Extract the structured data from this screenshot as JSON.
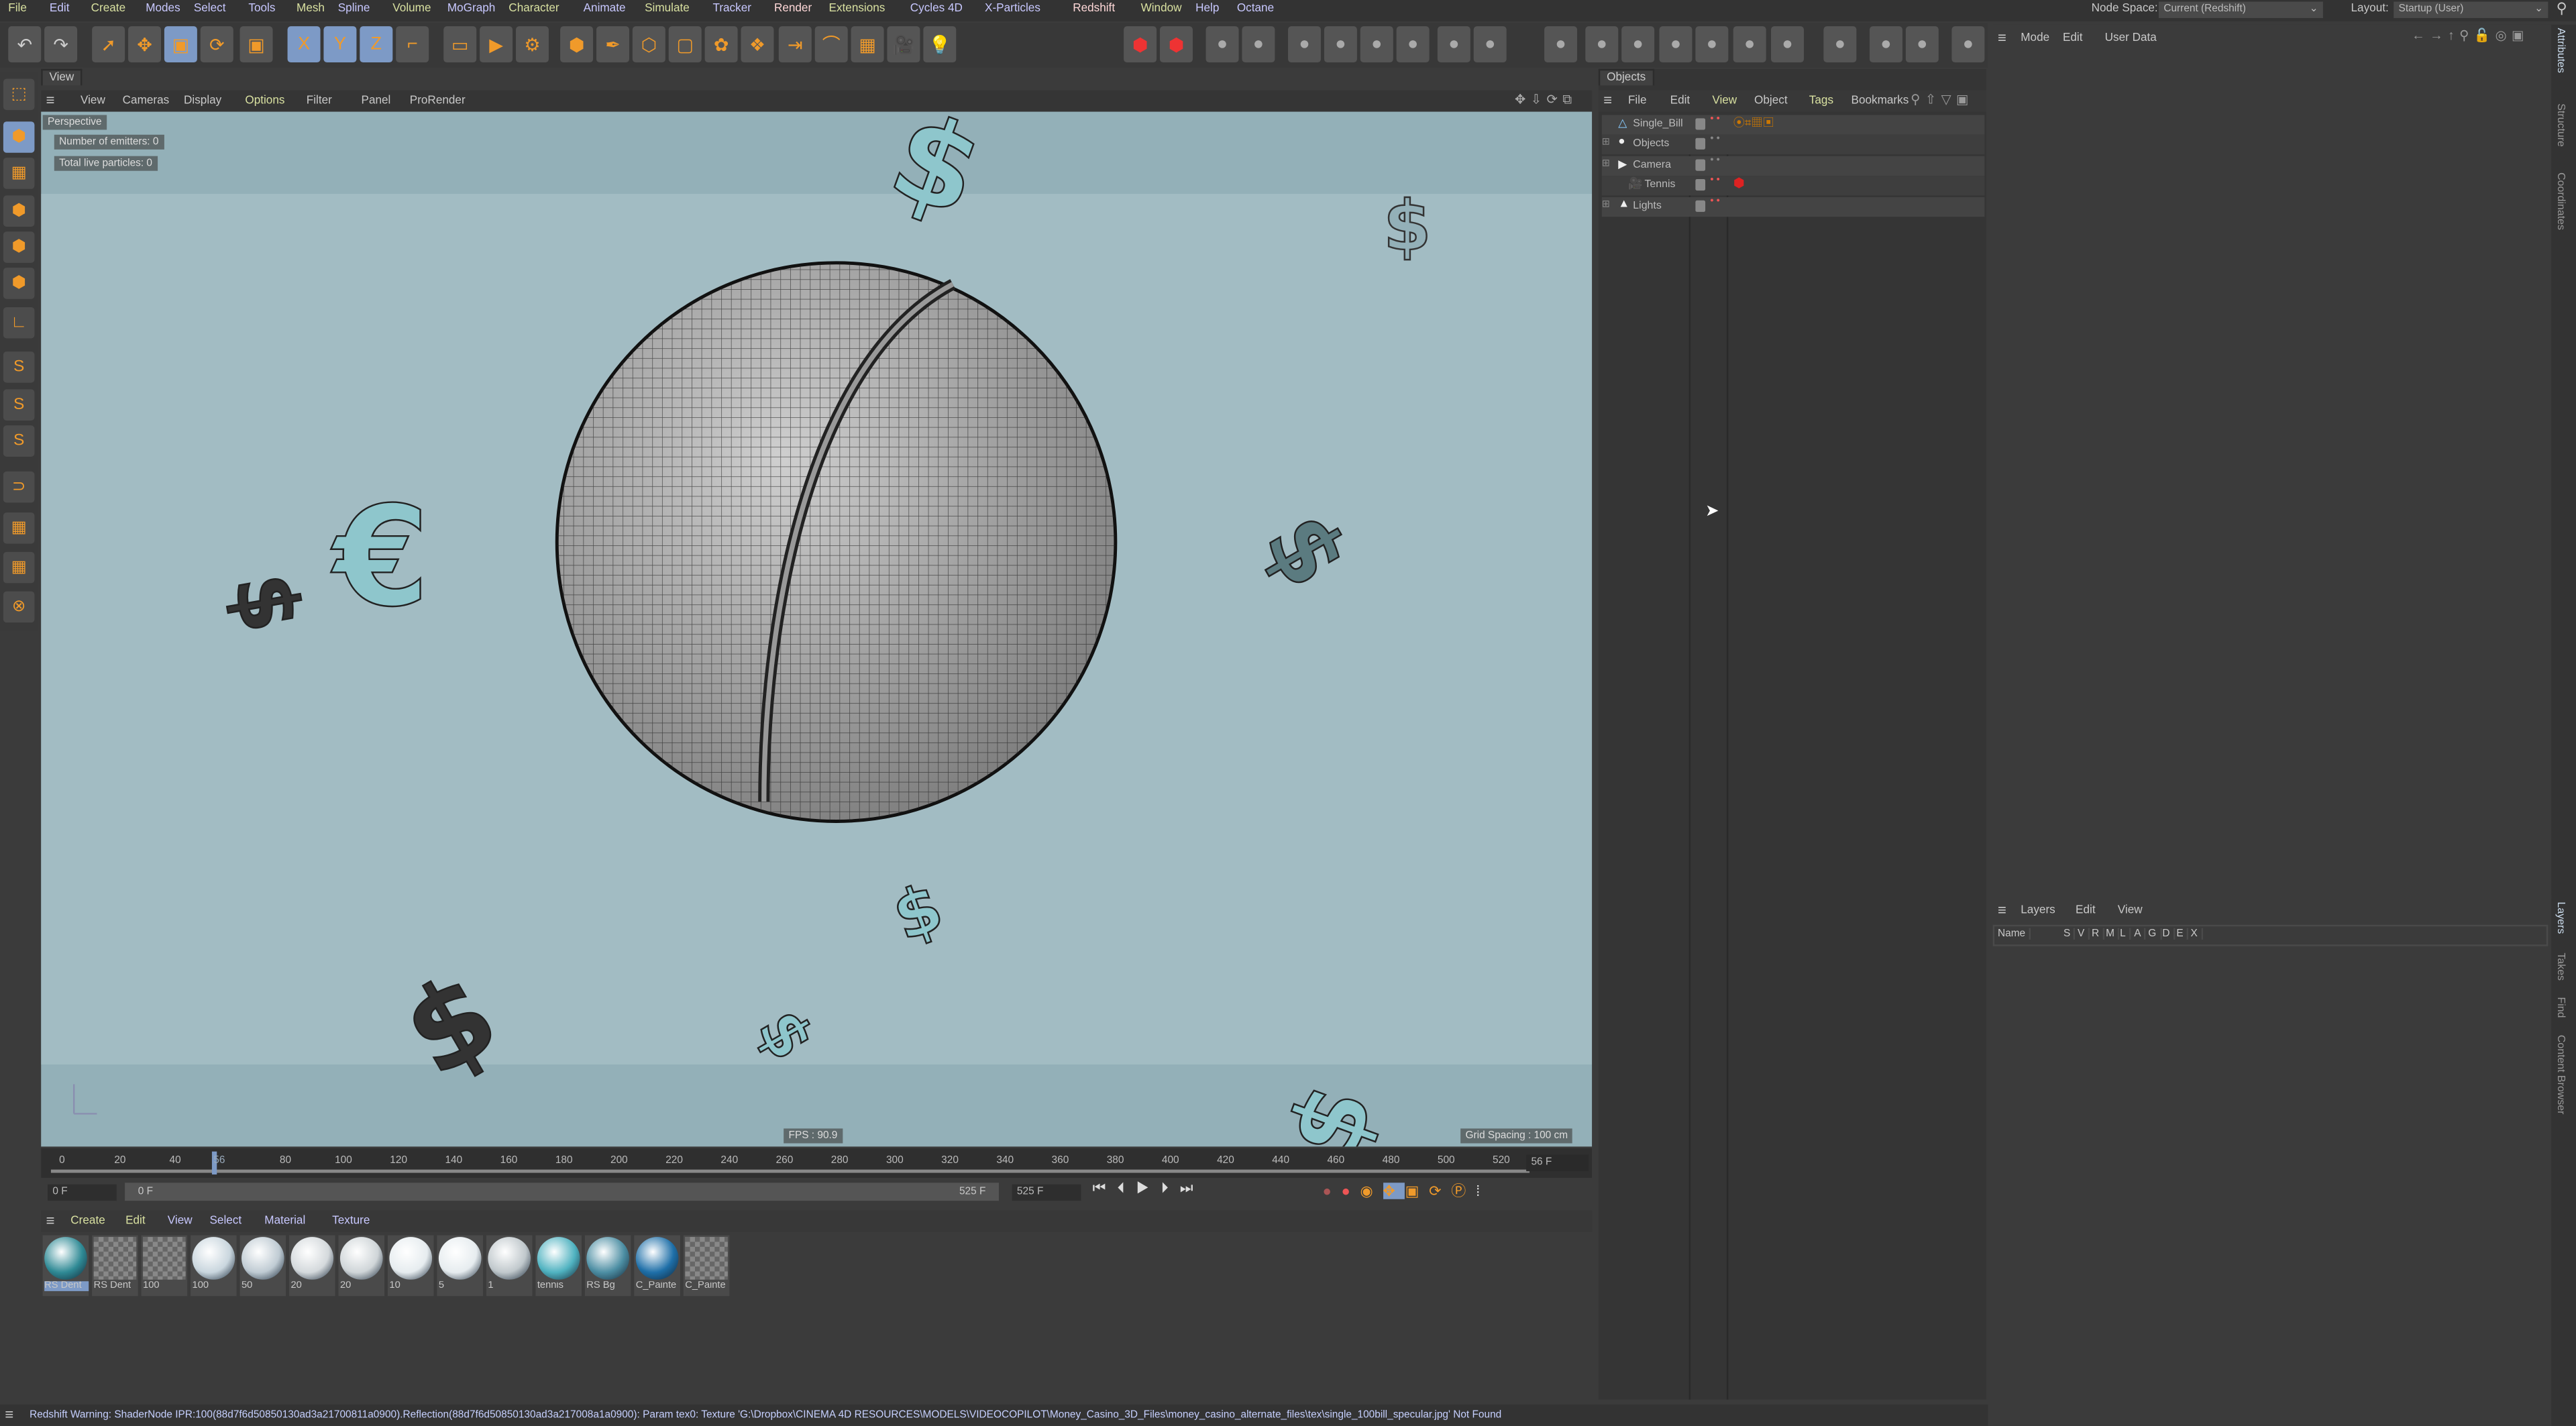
{
  "menubar": {
    "items": [
      "File",
      "Edit",
      "Create",
      "Modes",
      "Select",
      "Tools",
      "Mesh",
      "Spline",
      "Volume",
      "MoGraph",
      "Character",
      "Animate",
      "Simulate",
      "Tracker",
      "Render",
      "Extensions",
      "Cycles 4D",
      "X-Particles",
      "Redshift",
      "Window",
      "Help",
      "Octane"
    ],
    "node_space_label": "Node Space:",
    "node_space_value": "Current (Redshift)",
    "layout_label": "Layout:",
    "layout_value": "Startup (User)"
  },
  "toolbar": {
    "icons": [
      "undo-icon",
      "redo-icon",
      "select-icon",
      "move-icon",
      "scale-icon",
      "rotate-icon",
      "live-select-icon",
      "x-axis-icon",
      "y-axis-icon",
      "z-axis-icon",
      "coordinate-system-icon",
      "render-view-icon",
      "render-icon",
      "render-settings-icon",
      "cube-icon",
      "pen-icon",
      "subdivision-icon",
      "extrude-icon",
      "cloner-icon",
      "mograph-icon",
      "deformer-icon",
      "bend-icon",
      "floor-icon",
      "camera-icon",
      "light-icon"
    ],
    "axis_labels": [
      "X",
      "Y",
      "Z"
    ]
  },
  "viewport": {
    "tab": "View",
    "menu": [
      "View",
      "Cameras",
      "Display",
      "Options",
      "Filter",
      "Panel",
      "ProRender"
    ],
    "camera": "Perspective",
    "hud_emitters": "Number of emitters: 0",
    "hud_particles": "Total live particles: 0",
    "fps": "FPS : 90.9",
    "grid_spacing": "Grid Spacing : 100 cm",
    "background_color": "#93b0b8",
    "sky_color": "#a2bcc3",
    "symbol_color": "#8ec6cc"
  },
  "timeline": {
    "ticks": [
      "0",
      "20",
      "40",
      "56",
      "80",
      "100",
      "120",
      "140",
      "160",
      "180",
      "200",
      "220",
      "240",
      "260",
      "280",
      "300",
      "320",
      "340",
      "360",
      "380",
      "400",
      "420",
      "440",
      "460",
      "480",
      "500",
      "520"
    ],
    "current_frame": "56 F",
    "current_frame_value": 56,
    "start_field": "0 F",
    "range_start": "0 F",
    "range_end": "525 F",
    "end_field": "525 F"
  },
  "materials": {
    "menu": [
      "Create",
      "Edit",
      "View",
      "Select",
      "Material",
      "Texture"
    ],
    "items": [
      {
        "name": "RS Dent",
        "color": "#2f8a95"
      },
      {
        "name": "RS Dent",
        "color": "checker"
      },
      {
        "name": "100",
        "color": "checker"
      },
      {
        "name": "100",
        "color": "#c9d6de"
      },
      {
        "name": "50",
        "color": "#bfcbd3"
      },
      {
        "name": "20",
        "color": "#d4d9dc"
      },
      {
        "name": "20",
        "color": "#cfd5d8"
      },
      {
        "name": "10",
        "color": "#e6ecef"
      },
      {
        "name": "5",
        "color": "#e6ecef"
      },
      {
        "name": "1",
        "color": "#c0c8cc"
      },
      {
        "name": "tennis",
        "color": "#4fb2c0"
      },
      {
        "name": "RS Bg",
        "color": "#4c8ea3"
      },
      {
        "name": "C_Painte",
        "color": "#1e6fa8"
      },
      {
        "name": "C_Painte",
        "color": "checker"
      }
    ]
  },
  "objects": {
    "tab": "Objects",
    "menu": [
      "File",
      "Edit",
      "View",
      "Object",
      "Tags",
      "Bookmarks"
    ],
    "rows": [
      {
        "name": "Single_Bill",
        "icon": "polygon-object-icon"
      },
      {
        "name": "Objects",
        "icon": "null-object-icon"
      },
      {
        "name": "Camera",
        "icon": "clapper-icon"
      },
      {
        "name": "Tennis",
        "icon": "camera-icon"
      },
      {
        "name": "Lights",
        "icon": "light-object-icon"
      }
    ]
  },
  "attributes": {
    "menu": [
      "Mode",
      "Edit",
      "User Data"
    ]
  },
  "layers": {
    "menu": [
      "Layers",
      "Edit",
      "View"
    ],
    "columns": [
      "Name",
      "S",
      "V",
      "R",
      "M",
      "L",
      "A",
      "G",
      "D",
      "E",
      "X"
    ]
  },
  "side_tabs_top": [
    "Attributes",
    "Structure",
    "Coordinates"
  ],
  "side_tabs_bottom": [
    "Layers",
    "Takes",
    "Find",
    "Content Browser"
  ],
  "status": "Redshift Warning: ShaderNode IPR:100(88d7f6d50850130ad3a21700811a0900).Reflection(88d7f6d50850130ad3a217008a1a0900): Param tex0: Texture 'G:\\Dropbox\\CINEMA 4D RESOURCES\\MODELS\\VIDEOCOPILOT\\Money_Casino_3D_Files\\money_casino_alternate_files\\tex\\single_100bill_specular.jpg' Not Found"
}
